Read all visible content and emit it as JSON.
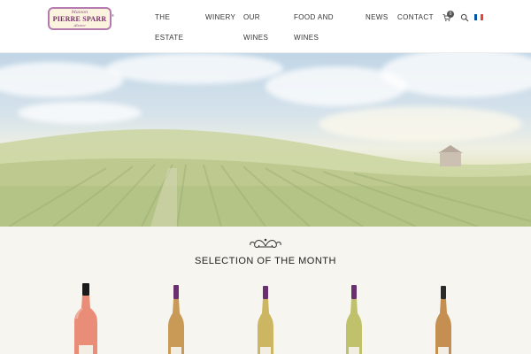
{
  "brand": {
    "top_line": "Maison",
    "name": "PIERRE SPARR",
    "tagline": "Alsace",
    "reg": "®"
  },
  "nav": {
    "the_estate_1": "THE",
    "the_estate_2": "ESTATE",
    "winery": "WINERY",
    "our_wines_1": "OUR",
    "our_wines_2": "WINES",
    "food_1": "FOOD AND",
    "food_2": "WINES",
    "news": "NEWS",
    "contact": "CONTACT"
  },
  "cart": {
    "count": "0",
    "icon": "cart-icon"
  },
  "search": {
    "icon": "search-icon"
  },
  "language": {
    "icon": "french-flag-icon",
    "colors": [
      "#0055a4",
      "#ffffff",
      "#ef4135"
    ]
  },
  "selection": {
    "title": "SELECTION OF THE MONTH",
    "bottles": [
      {
        "name": "rose-cremant",
        "glass": "#d9806a",
        "capsule": "#1a1a1a",
        "wine": "#f2a08a"
      },
      {
        "name": "white-wine-2",
        "glass": "#c89a56",
        "capsule": "#6a2f6e",
        "wine": "#caa067"
      },
      {
        "name": "white-wine-3",
        "glass": "#c7b35f",
        "capsule": "#6a2f6e",
        "wine": "#d3bf6a"
      },
      {
        "name": "white-wine-4",
        "glass": "#b9bd63",
        "capsule": "#6a2f6e",
        "wine": "#c9c976"
      },
      {
        "name": "white-wine-5",
        "glass": "#c58f52",
        "capsule": "#2a2a2a",
        "wine": "#c99257"
      }
    ]
  }
}
